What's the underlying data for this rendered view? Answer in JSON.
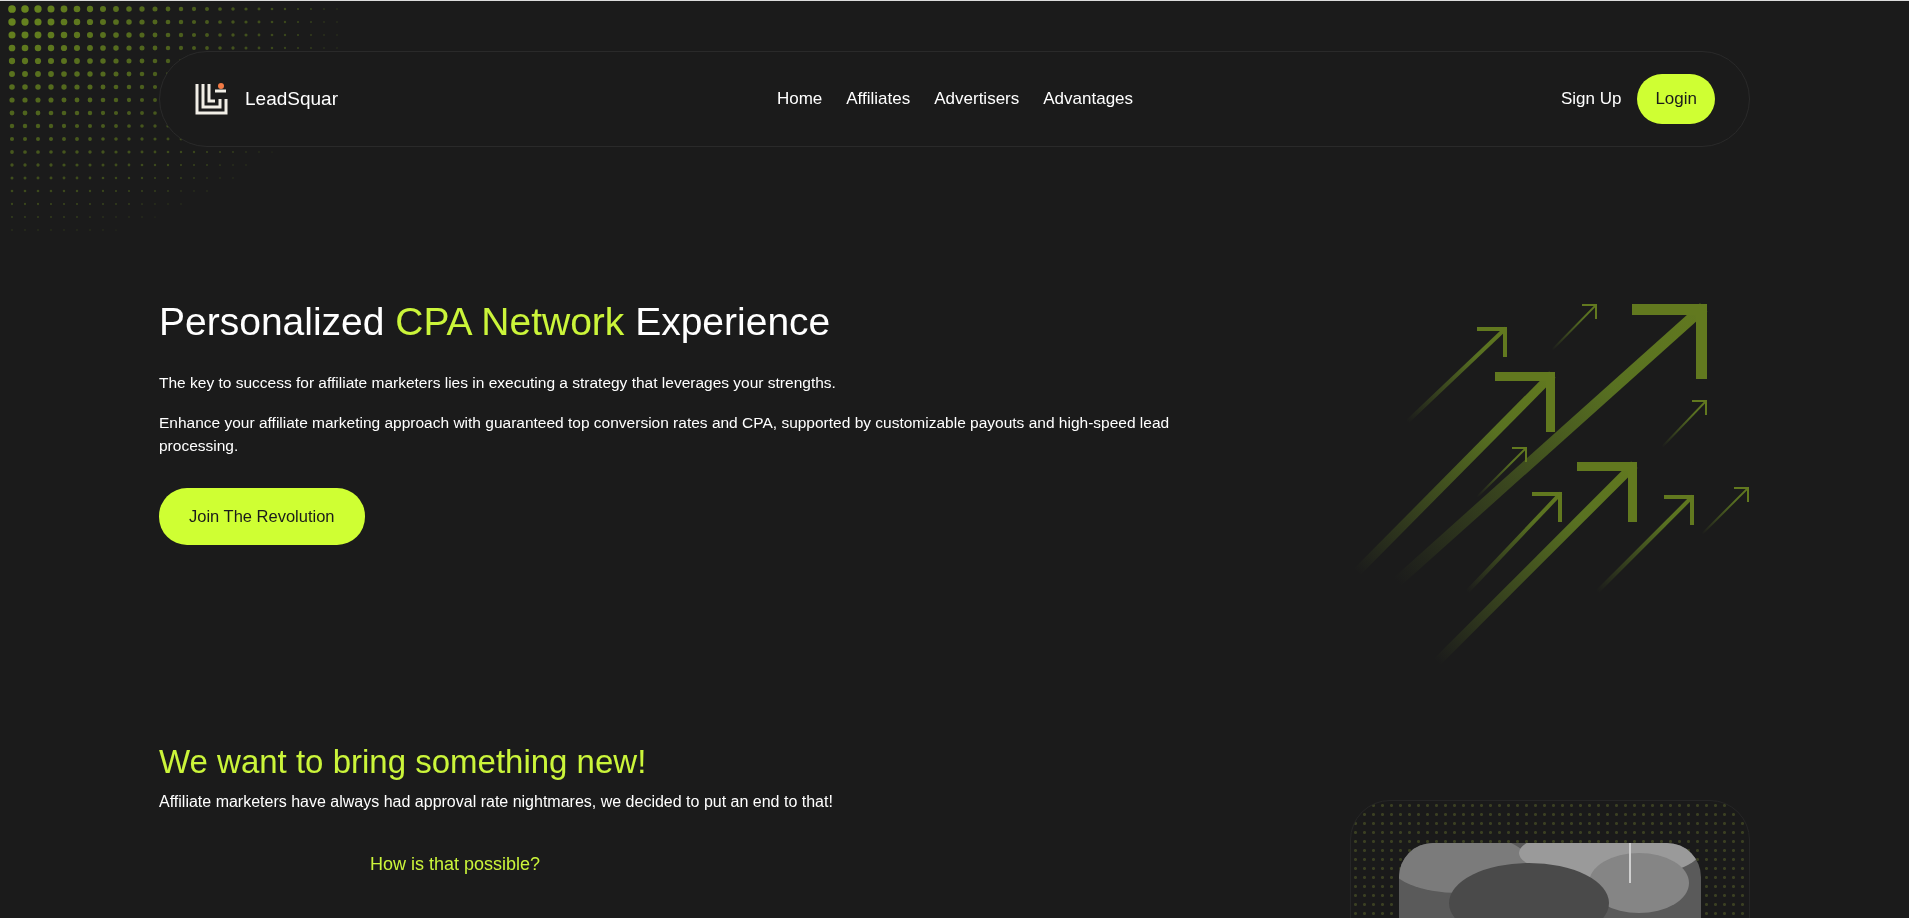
{
  "nav": {
    "brand": "LeadSquar",
    "links": [
      {
        "label": "Home"
      },
      {
        "label": "Affiliates"
      },
      {
        "label": "Advertisers"
      },
      {
        "label": "Advantages"
      }
    ],
    "sign_up": "Sign Up",
    "login": "Login"
  },
  "hero": {
    "title": {
      "before": "Personalized ",
      "highlight": "CPA Network",
      "after": " Experience"
    },
    "paragraphs": [
      "The key to success for affiliate marketers lies in executing a strategy that leverages your strengths.",
      "Enhance your affiliate marketing approach with guaranteed top conversion rates and CPA, supported by customizable payouts and high-speed lead processing."
    ],
    "button": "Join The Revolution"
  },
  "intro": {
    "title": "We want to bring something new!",
    "text": "Affiliate marketers have always had approval rate nightmares, we decided to put an end to that!",
    "subtitle": "How is that possible?"
  }
}
